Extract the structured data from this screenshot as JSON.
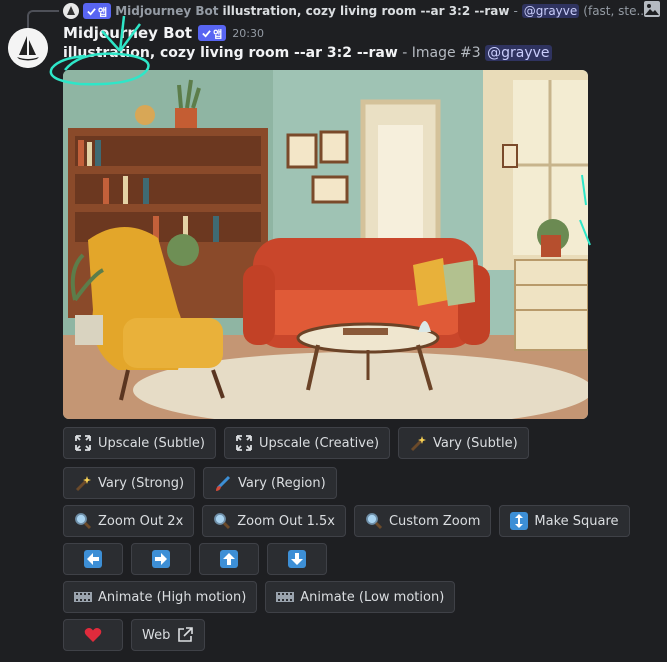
{
  "reply": {
    "bot_name": "Midjourney Bot",
    "badge": "앱",
    "prompt": "illustration, cozy living room --ar 3:2 --raw",
    "separator": " - ",
    "mention": "@grayve",
    "tail": " (fast, ste..."
  },
  "message": {
    "author": "Midjourney Bot",
    "badge": "앱",
    "time": "20:30",
    "prompt": "illustration, cozy living room --ar 3:2 --raw",
    "suffix": " - Image #3 ",
    "mention": "@grayve"
  },
  "buttons": {
    "upscale_subtle": "Upscale (Subtle)",
    "upscale_creative": "Upscale (Creative)",
    "vary_subtle": "Vary (Subtle)",
    "vary_strong": "Vary (Strong)",
    "vary_region": "Vary (Region)",
    "zoom_2x": "Zoom Out 2x",
    "zoom_15x": "Zoom Out 1.5x",
    "custom_zoom": "Custom Zoom",
    "make_square": "Make Square",
    "animate_high": "Animate (High motion)",
    "animate_low": "Animate (Low motion)",
    "web": "Web"
  },
  "icons": {
    "arrows": [
      "arrow-left-icon",
      "arrow-right-icon",
      "arrow-up-icon",
      "arrow-down-icon"
    ],
    "heart": "heart-icon"
  },
  "colors": {
    "background": "#1e1f22",
    "button": "#2b2d31",
    "badge": "#5865f2",
    "arrow_blue": "#3d8fd6",
    "heart": "#e02b3c",
    "annotation": "#2ee6c8"
  }
}
